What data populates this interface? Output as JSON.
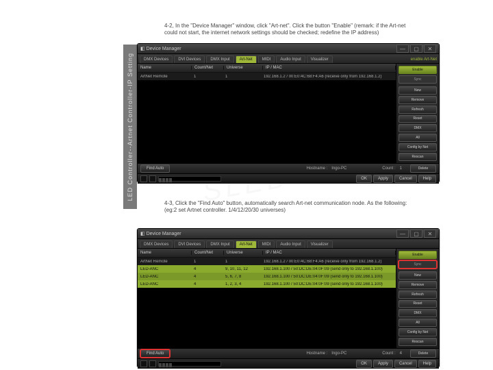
{
  "sidebar_label": "LED Controller--Artnet Controller-IP Setting",
  "instruction_42": "4-2, In the \"Device Manager\" window, click \"Art-net\". Click the button \"Enable\" (remark: if the Art-net could not start, the internet network settings should be checked; redefine the IP address)",
  "instruction_43": "4-3, Click the \"Find Auto\" button, automatically search Art-net communication node. As the following: (eg:2 set Artnet controller. 1/4/12/20/30 universes)",
  "dm": {
    "title": "Device Manager",
    "tabs": [
      "DMX Devices",
      "DVI Devices",
      "DMX Input",
      "Art-Net",
      "MIDI",
      "Audio Input",
      "Visualizer"
    ],
    "active_tab": 3,
    "headers": {
      "name": "Name",
      "count": "Count/Net",
      "universe": "Universe",
      "ip": "IP / MAC"
    },
    "footer": {
      "findauto": "Find Auto",
      "hostname_label": "Hostname :",
      "hostname": "Ingo-PC",
      "count_label": "Count :"
    },
    "buttons": {
      "ok": "OK",
      "apply": "Apply",
      "cancel": "Cancel",
      "help": "Help"
    },
    "side": {
      "toplabel": "enable Art-Net",
      "enable": "Enable",
      "sync": "Sync",
      "new": "New",
      "remove": "Remove",
      "refresh": "Refresh",
      "reset": "Reset",
      "dmx": "DMX",
      "all": "All",
      "config": "Config by Net",
      "rescan": "Rescan"
    }
  },
  "screen1": {
    "count": "1",
    "rows": [
      {
        "name": "ArtNet Remote",
        "count": "1",
        "universe": "1",
        "ip": "192.168.1.2 / 00:E0:4C:68:F4:A6 (receive only from 192.168.1.2)"
      }
    ]
  },
  "screen2": {
    "count": "4",
    "rows": [
      {
        "name": "ArtNet Remote",
        "count": "1",
        "universe": "1",
        "ip": "192.168.1.2 / 00:E0:4C:68:F4:A6 (receive only from 192.168.1.2)",
        "cls": "dark"
      },
      {
        "name": "LED-ANC",
        "count": "4",
        "universe": "9, 10, 11, 12",
        "ip": "192.168.1.100 / 50:DC:DE:04:0F:09 (send only to 192.168.1.100)",
        "cls": "green"
      },
      {
        "name": "LED-ANC",
        "count": "4",
        "universe": "5, 6, 7, 8",
        "ip": "192.168.1.100 / 50:DC:DE:04:0F:09 (send only to 192.168.1.100)",
        "cls": "green2"
      },
      {
        "name": "LED-ANC",
        "count": "4",
        "universe": "1, 2, 3, 4",
        "ip": "192.168.1.100 / 50:DC:DE:04:0F:09 (send only to 192.168.1.100)",
        "cls": "green"
      }
    ]
  },
  "watermark": "SLED"
}
